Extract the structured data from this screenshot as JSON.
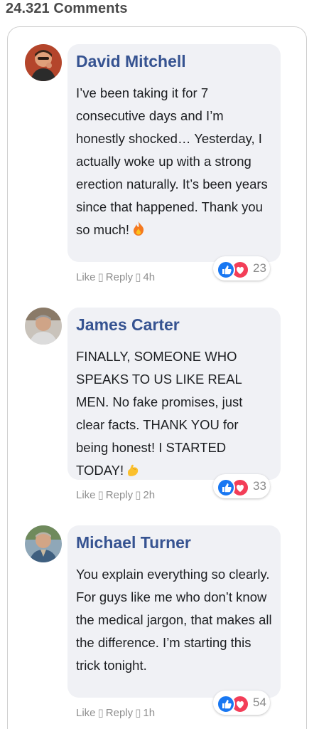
{
  "header": {
    "comment_count": "24.321 Comments"
  },
  "comments": [
    {
      "author": "David Mitchell",
      "text": "I’ve been taking it for 7 consecutive days and I’m honestly shocked… Yesterday, I actually woke up with a strong erection naturally. It’s been years since that happened. Thank you so much!",
      "emoji": "fire-emoji",
      "like_label": "Like",
      "separator": "▯",
      "reply_label": "Reply",
      "time": "4h",
      "reaction_count": "23",
      "reaction_icons": [
        "like-icon",
        "love-icon"
      ]
    },
    {
      "author": "James Carter",
      "text": "FINALLY, SOMEONE WHO SPEAKS TO US LIKE REAL MEN. No fake promises, just clear facts. THANK YOU for being honest! I STARTED TODAY!",
      "emoji": "flexed-biceps-emoji",
      "like_label": "Like",
      "separator": "▯",
      "reply_label": "Reply",
      "time": "2h",
      "reaction_count": "33",
      "reaction_icons": [
        "like-icon",
        "love-icon"
      ]
    },
    {
      "author": "Michael Turner",
      "text": "You explain everything so clearly. For guys like me who don’t know the medical jargon, that makes all the difference. I’m starting this trick tonight.",
      "emoji": "",
      "like_label": "Like",
      "separator": "▯",
      "reply_label": "Reply",
      "time": "1h",
      "reaction_count": "54",
      "reaction_icons": [
        "like-icon",
        "love-icon"
      ]
    }
  ],
  "colors": {
    "author_name": "#365391",
    "bubble_bg": "#f0f1f5",
    "like_blue": "#1877f2",
    "love_red": "#f33e58",
    "meta_gray": "#8e8e8e"
  }
}
